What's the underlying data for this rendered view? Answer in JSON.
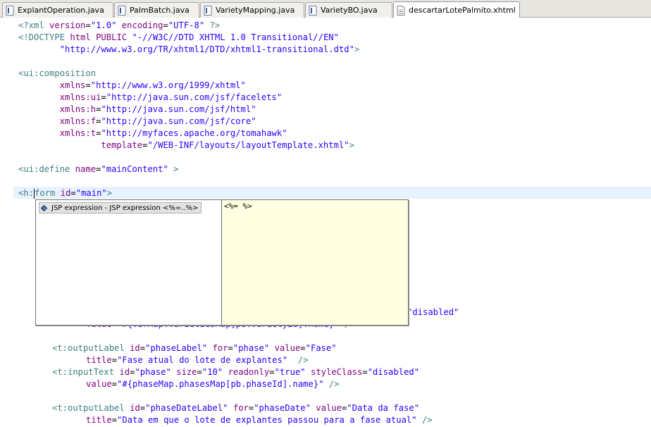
{
  "tabs": [
    {
      "label": "ExplantOperation.java",
      "icon": "java-file-icon",
      "active": false
    },
    {
      "label": "PalmBatch.java",
      "icon": "java-file-icon",
      "active": false
    },
    {
      "label": "VarietyMapping.java",
      "icon": "java-file-icon",
      "active": false
    },
    {
      "label": "VarietyBO.java",
      "icon": "java-file-icon",
      "active": false
    },
    {
      "label": "descartarLotePalmito.xhtml",
      "icon": "xhtml-file-icon",
      "active": true,
      "close_glyph": "✕"
    }
  ],
  "editor": {
    "lines": [
      "<?xml version=\"1.0\" encoding=\"UTF-8\" ?>",
      "<!DOCTYPE html PUBLIC \"-//W3C//DTD XHTML 1.0 Transitional//EN\"",
      "        \"http://www.w3.org/TR/xhtml1/DTD/xhtml1-transitional.dtd\">",
      "",
      "<ui:composition",
      "        xmlns=\"http://www.w3.org/1999/xhtml\"",
      "        xmlns:ui=\"http://java.sun.com/jsf/facelets\"",
      "        xmlns:h=\"http://java.sun.com/jsf/html\"",
      "        xmlns:f=\"http://java.sun.com/jsf/core\"",
      "        xmlns:t=\"http://myfaces.apache.org/tomahawk\"",
      "                template=\"/WEB-INF/layouts/layoutTemplate.xhtml\">",
      "",
      "<ui:define name=\"mainContent\" >",
      "",
      "<h:form id=\"main\">",
      "  <",
      "\"",
      "\"disabled\"",
      "value=\"#{varMap.varietiesMap[pb.varietyId].name}\" />",
      "<t:outputLabel id=\"phaseLabel\" for=\"phase\" value=\"Fase\"",
      "title=\"Fase atual do lote de explantes\"  />",
      "<t:inputText id=\"phase\" size=\"10\" readonly=\"true\" styleClass=\"disabled\"",
      "value=\"#{phaseMap.phasesMap[pb.phaseId].name}\" />",
      "<t:outputLabel id=\"phaseDateLabel\" for=\"phaseDate\" value=\"Data da fase\"",
      "title=\"Data em que o lote de explantes passou para a fase atual\" />"
    ]
  },
  "content_assist": {
    "proposal": "JSP expression - JSP expression <%=..%>",
    "proposal_icon": "template-icon",
    "doc": "<%= %>"
  },
  "colors": {
    "tag": "#3f7f7f",
    "attribute_name": "#7f007f",
    "attribute_value": "#2a00ff",
    "current_line": "#e8f2fe",
    "doc_background": "#ffffe1"
  }
}
